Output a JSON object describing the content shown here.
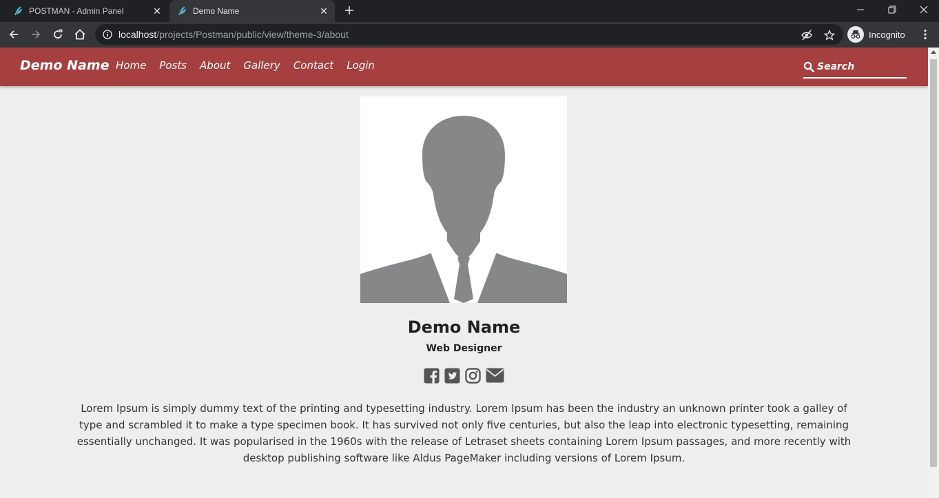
{
  "browser": {
    "tabs": [
      {
        "title": "POSTMAN - Admin Panel",
        "active": false
      },
      {
        "title": "Demo Name",
        "active": true
      }
    ],
    "url": {
      "host": "localhost",
      "path": "/projects/Postman/public/view/theme-3/about"
    },
    "profile_label": "Incognito"
  },
  "site": {
    "brand": "Demo Name",
    "nav": [
      "Home",
      "Posts",
      "About",
      "Gallery",
      "Contact",
      "Login"
    ],
    "search_placeholder": "Search",
    "accent_color": "#a63f3f"
  },
  "profile": {
    "name": "Demo Name",
    "role": "Web Designer",
    "socials": [
      "facebook-icon",
      "twitter-icon",
      "instagram-icon",
      "envelope-icon"
    ],
    "bio": "Lorem Ipsum is simply dummy text of the printing and typesetting industry. Lorem Ipsum has been the industry an unknown printer took a galley of type and scrambled it to make a type specimen book. It has survived not only five centuries, but also the leap into electronic typesetting, remaining essentially unchanged. It was popularised in the 1960s with the release of Letraset sheets containing Lorem Ipsum passages, and more recently with desktop publishing software like Aldus PageMaker including versions of Lorem Ipsum."
  }
}
